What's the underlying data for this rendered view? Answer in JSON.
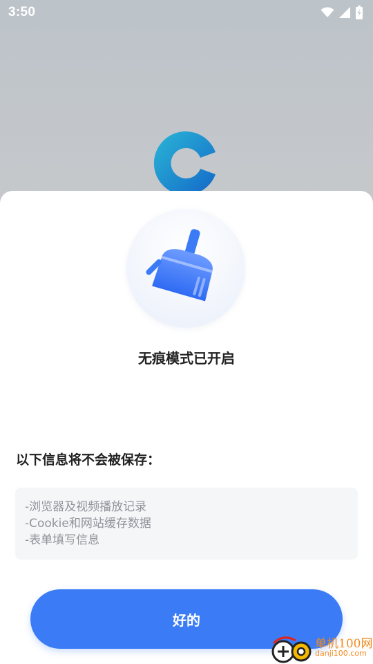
{
  "status_bar": {
    "time": "3:50",
    "icons": [
      "wifi-icon",
      "signal-icon",
      "battery-charging-icon"
    ]
  },
  "app": {
    "logo": "browser-c-logo"
  },
  "dialog": {
    "icon": "broom-clean-icon",
    "title": "无痕模式已开启",
    "notice_label": "以下信息将不会被保存：",
    "items": [
      "-浏览器及视频播放记录",
      "-Cookie和网站缓存数据",
      "-表单填写信息"
    ],
    "ok_label": "好的"
  },
  "watermark": {
    "line1": "单机100网",
    "line2": "danji100.com"
  },
  "colors": {
    "accent": "#3b7cf6",
    "title_text": "#222222",
    "muted_text": "#8f9399",
    "info_bg": "#f5f6f8",
    "watermark": "#f18a1e"
  }
}
